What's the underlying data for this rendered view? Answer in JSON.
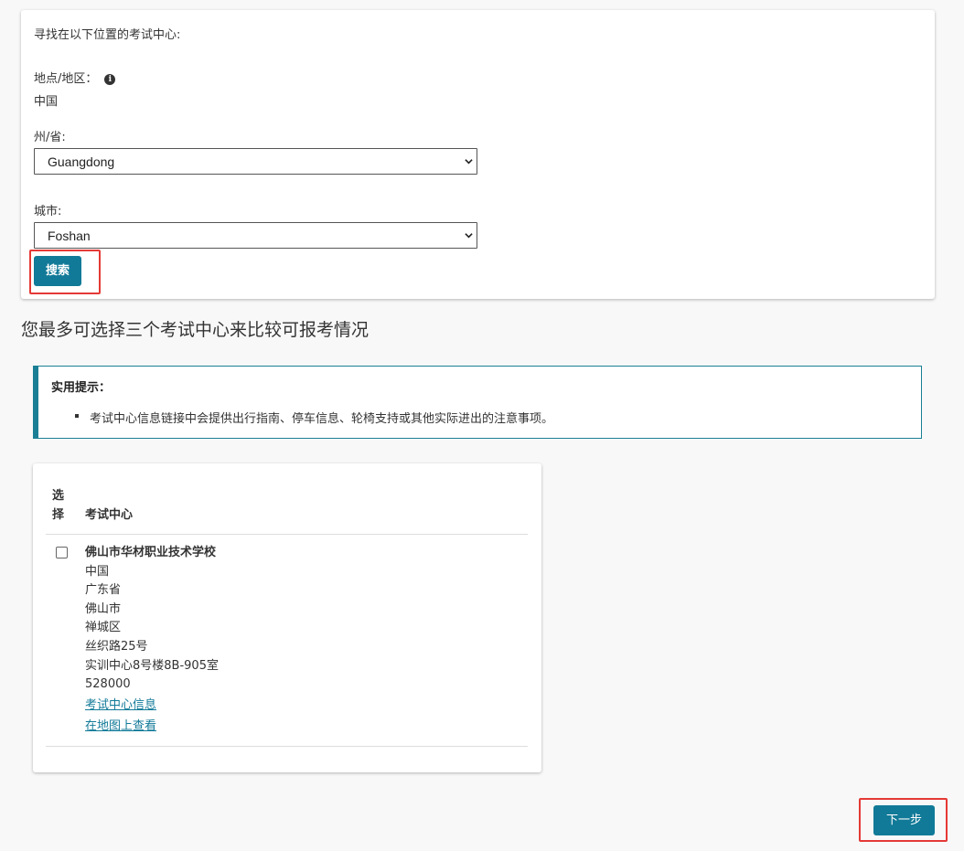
{
  "search": {
    "intro": "寻找在以下位置的考试中心:",
    "location_label": "地点/地区：",
    "location_value": "中国",
    "province_label": "州/省:",
    "province_value": "Guangdong",
    "city_label": "城市:",
    "city_value": "Foshan",
    "search_button": "搜索"
  },
  "compare_heading": "您最多可选择三个考试中心来比较可报考情况",
  "tip": {
    "title": "实用提示：",
    "items": [
      "考试中心信息链接中会提供出行指南、停车信息、轮椅支持或其他实际进出的注意事项。"
    ]
  },
  "table": {
    "col_select": "选择",
    "col_center": "考试中心",
    "rows": [
      {
        "name": "佛山市华材职业技术学校",
        "country": "中国",
        "province": "广东省",
        "city": "佛山市",
        "district": "禅城区",
        "street": "丝织路25号",
        "room": "实训中心8号楼8B-905室",
        "postcode": "528000",
        "info_link": "考试中心信息",
        "map_link": "在地图上查看"
      }
    ]
  },
  "next_button": "下一步",
  "colors": {
    "accent": "#117a98",
    "highlight": "#e53935"
  }
}
